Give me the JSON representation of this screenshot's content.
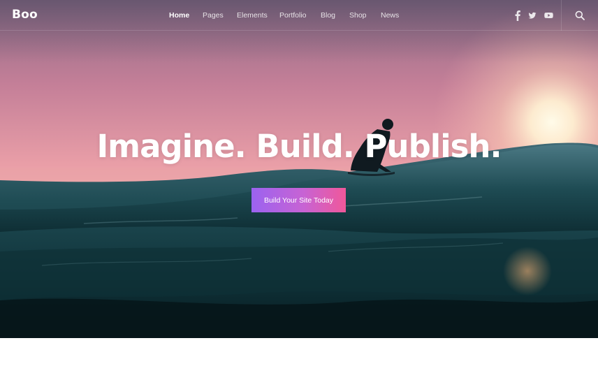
{
  "header": {
    "logo": "Boo",
    "nav": [
      {
        "label": "Home",
        "active": true
      },
      {
        "label": "Pages",
        "active": false
      },
      {
        "label": "Elements",
        "active": false
      },
      {
        "label": "Portfolio",
        "active": false
      },
      {
        "label": "Blog",
        "active": false
      },
      {
        "label": "Shop",
        "active": false
      },
      {
        "label": "News",
        "active": false
      }
    ],
    "social_icons": [
      "facebook-icon",
      "twitter-icon",
      "youtube-icon"
    ],
    "search_icon": "search-icon"
  },
  "hero": {
    "headline": "Imagine. Build. Publish.",
    "cta_label": "Build Your Site Today"
  },
  "colors": {
    "cta_gradient_start": "#9b63f0",
    "cta_gradient_end": "#f0589a",
    "sky_top": "#a56e8c",
    "sky_mid": "#e79aa6",
    "sea_dark": "#0d2d33"
  }
}
